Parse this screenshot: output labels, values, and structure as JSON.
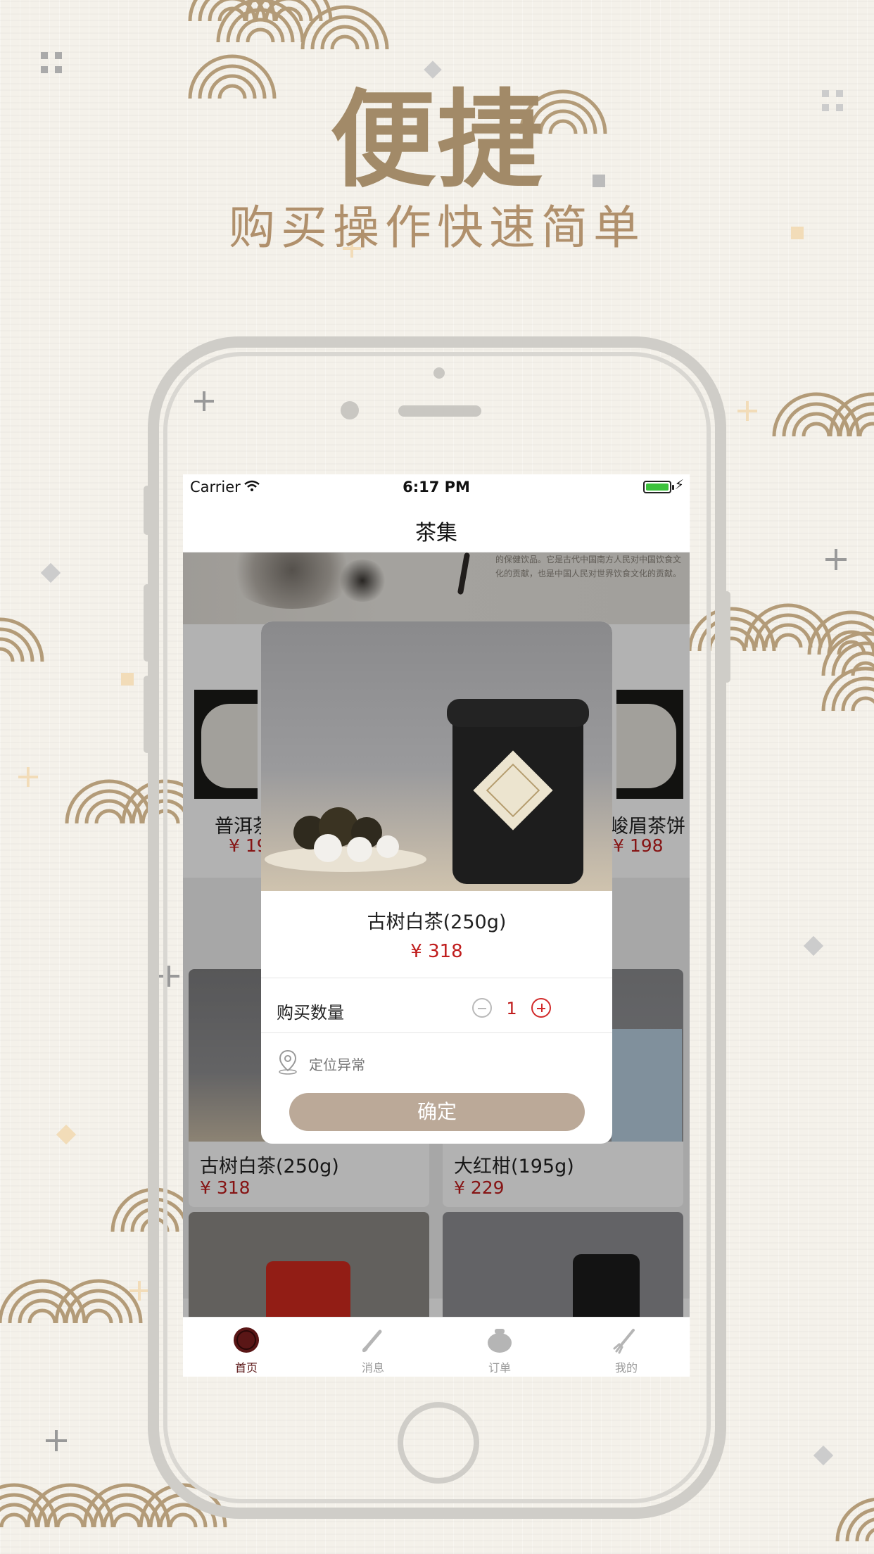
{
  "hero": {
    "title": "便捷",
    "subtitle": "购买操作快速简单"
  },
  "status_bar": {
    "carrier": "Carrier",
    "time": "6:17 PM"
  },
  "nav": {
    "title": "茶集"
  },
  "banner": {
    "text": "的保健饮品。它是古代中国南方人民对中国饮食文化的贡献，也是中国人民对世界饮食文化的贡献。"
  },
  "products": [
    {
      "name": "普洱茶",
      "price": "¥ 19"
    },
    {
      "name": "峻眉茶饼",
      "price": "¥ 198"
    },
    {
      "name": "古树白茶(250g)",
      "price": "¥ 318"
    },
    {
      "name": "大红柑(195g)",
      "price": "¥ 229"
    }
  ],
  "modal": {
    "product_name": "古树白茶(250g)",
    "price": "¥ 318",
    "quantity_label": "购买数量",
    "quantity": "1",
    "location_text": "定位异常",
    "confirm_label": "确定"
  },
  "tabs": [
    {
      "label": "首页",
      "active": true
    },
    {
      "label": "消息",
      "active": false
    },
    {
      "label": "订单",
      "active": false
    },
    {
      "label": "我的",
      "active": false
    }
  ],
  "colors": {
    "accent": "#a28a68",
    "price": "#c01d1d",
    "confirm": "#bba998",
    "active_tab": "#5a1616"
  }
}
